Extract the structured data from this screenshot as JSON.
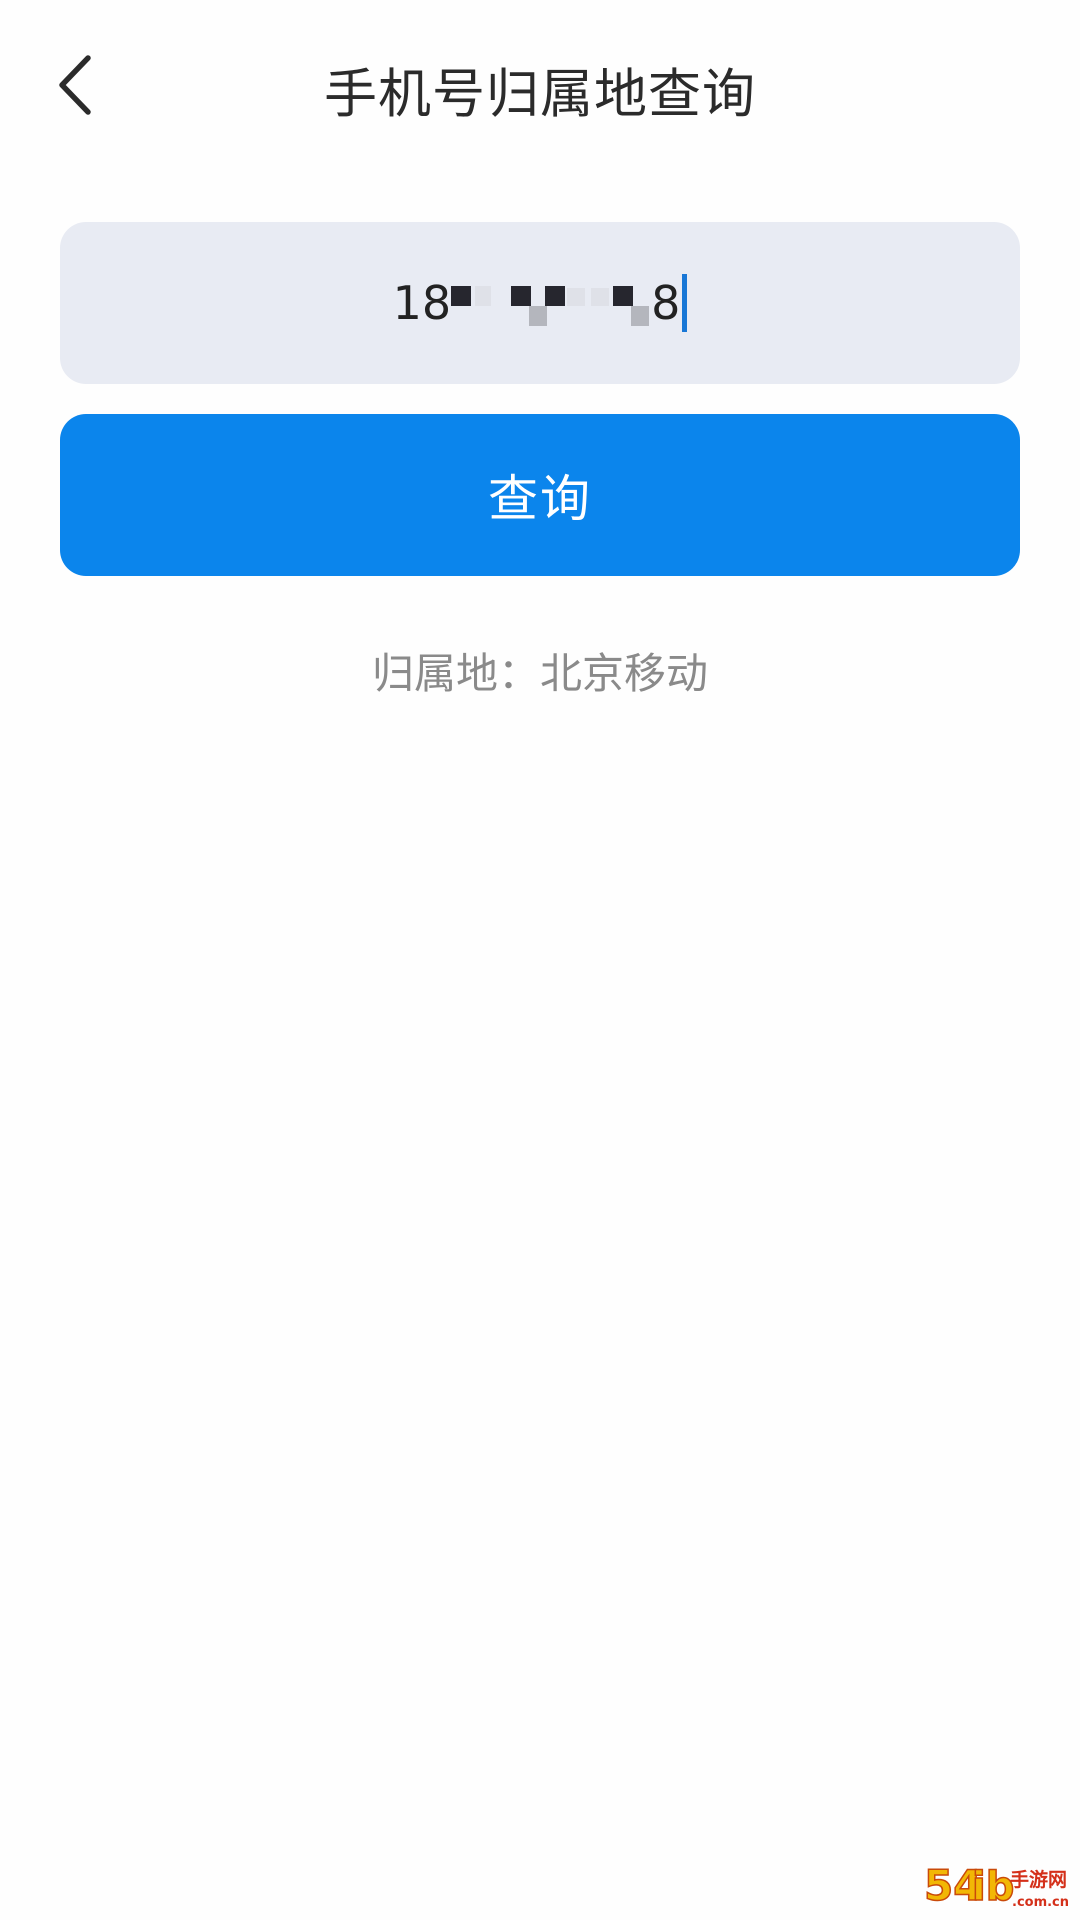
{
  "header": {
    "back_icon": "chevron-left-icon",
    "title": "手机号归属地查询"
  },
  "phone_input": {
    "visible_prefix": "18",
    "visible_suffix": "8",
    "masked": true,
    "background_color": "#e8ebf3",
    "caret_color": "#1877d6"
  },
  "query_button": {
    "label": "查询",
    "color": "#0b85ec"
  },
  "result": {
    "text": "归属地：北京移动"
  },
  "watermark": {
    "text": "54ib手游网 .com.cn"
  }
}
